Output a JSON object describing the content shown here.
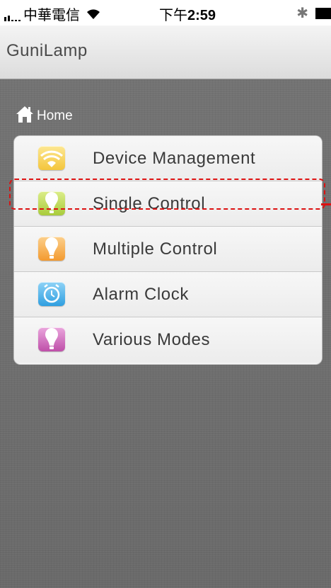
{
  "status_bar": {
    "carrier": "中華電信",
    "time": "2:59",
    "time_prefix": "下午"
  },
  "nav": {
    "title": "GuniLamp"
  },
  "breadcrumb": {
    "label": "Home"
  },
  "menu": {
    "items": [
      {
        "label": "Device Management",
        "icon": "wifi-icon",
        "color": "#f7d35a"
      },
      {
        "label": "Single Control",
        "icon": "bulb-icon",
        "color": "#b8d64b"
      },
      {
        "label": "Multiple Control",
        "icon": "bulb-icon",
        "color": "#f5a23c"
      },
      {
        "label": "Alarm Clock",
        "icon": "alarm-clock-icon",
        "color": "#3aa9e6"
      },
      {
        "label": "Various Modes",
        "icon": "bulb-icon",
        "color": "#c85fb3"
      }
    ]
  },
  "annotation": {
    "highlight_color": "#dd1111"
  }
}
